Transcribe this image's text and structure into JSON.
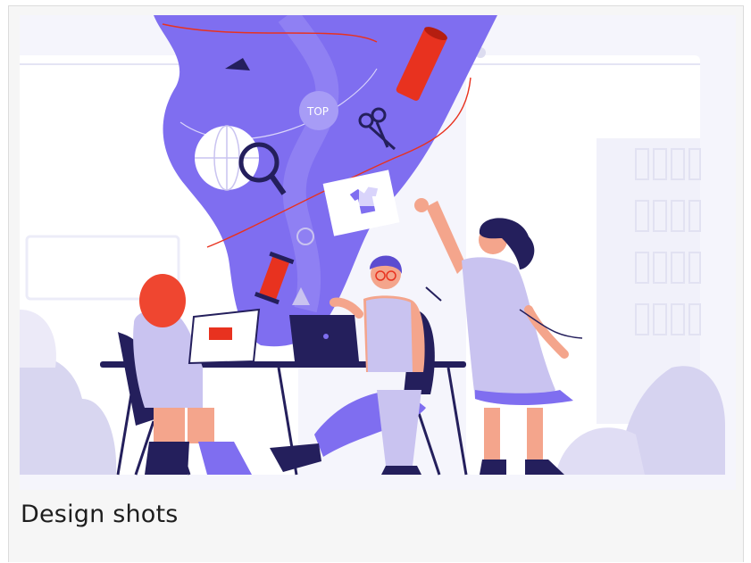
{
  "card": {
    "title": "Design shots",
    "illustration_icon": "team-design-illustration",
    "colors": {
      "accent": "#7f6ef0",
      "accent_dark": "#241f5c",
      "accent_light": "#c9c3f0",
      "highlight": "#e8321f",
      "skin": "#f4a58c",
      "hair_red": "#ef4630",
      "background": "#f5f5fc"
    }
  }
}
